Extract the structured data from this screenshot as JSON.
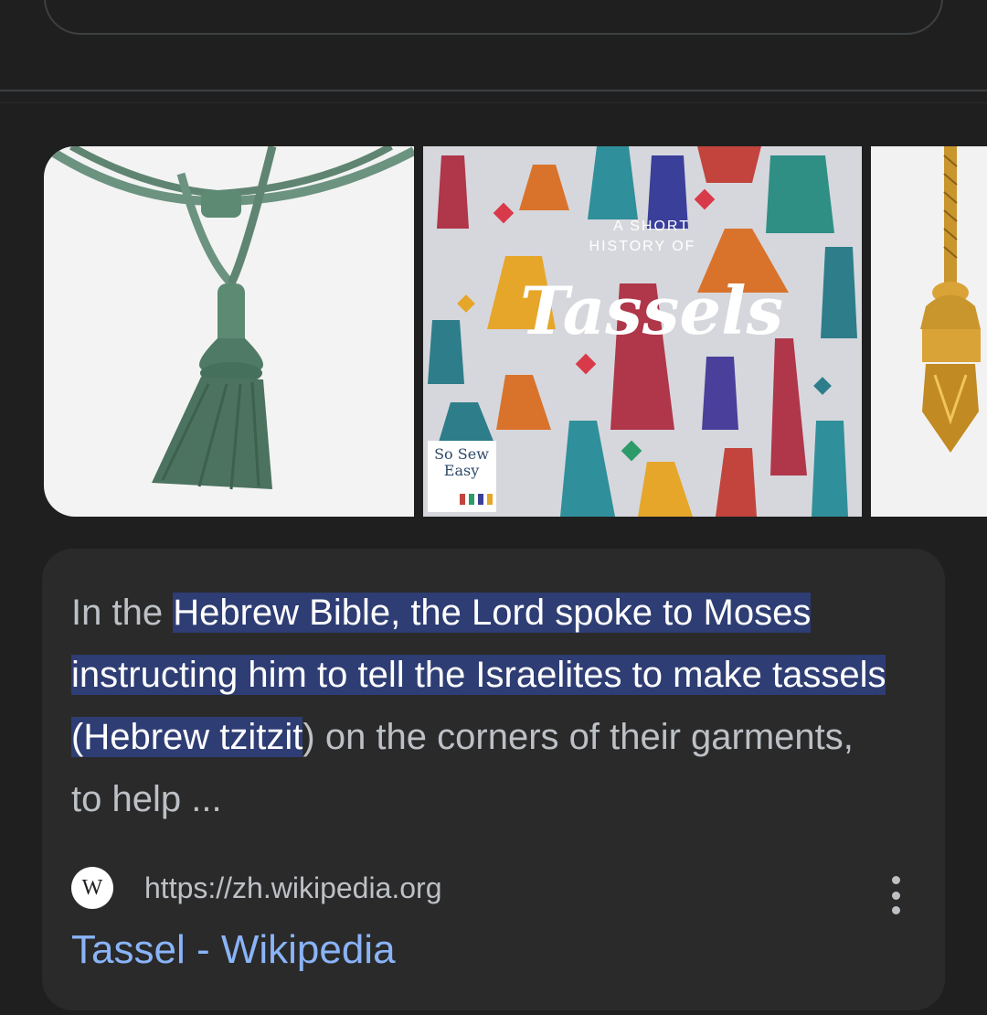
{
  "result": {
    "snippet_prefix": "In the ",
    "snippet_highlight": "Hebrew Bible, the Lord spoke to Moses instructing him to tell the Israelites to make tassels (Hebrew tzitzit",
    "snippet_suffix": ") on the corners of their garments, to help ...",
    "favicon_letter": "W",
    "source_url": "https://zh.wikipedia.org",
    "title": "Tassel - Wikipedia"
  },
  "images": {
    "items": [
      {
        "alt": "green tassel",
        "icon": "tassel-image"
      },
      {
        "alt": "A SHORT HISTORY OF Tassels",
        "icon": "tassel-poster-image",
        "overlay_small": "A SHORT HISTORY OF",
        "overlay_big": "Tassels",
        "badge": "So Sew Easy"
      },
      {
        "alt": "gold tassel",
        "icon": "tassel-image"
      }
    ]
  },
  "colors": {
    "background": "#1f1f1f",
    "card": "#2a2a2a",
    "highlight": "#2e3d73",
    "link": "#8ab4f8",
    "muted_text": "#bdc1c6"
  }
}
